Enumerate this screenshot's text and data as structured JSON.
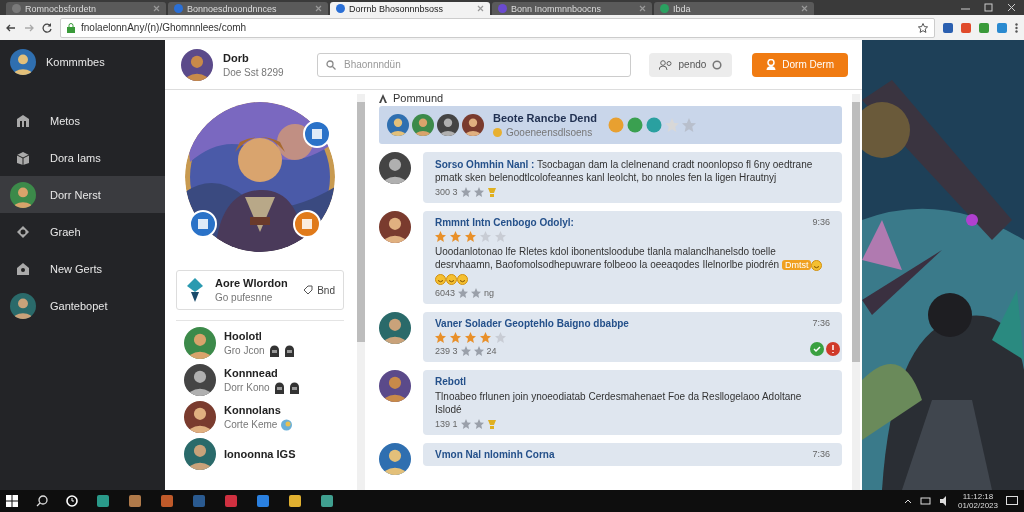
{
  "browser": {
    "tabs": [
      {
        "label": "Romnocbsfordetn",
        "selected": false
      },
      {
        "label": "Bonnoesdnoondnnces",
        "selected": false
      },
      {
        "label": "Dorrnb Bhosonnnbsoss",
        "selected": true
      },
      {
        "label": "Bonn Inommnnboocns",
        "selected": false
      },
      {
        "label": "Ibda",
        "selected": false
      }
    ],
    "url": "fnolaelonnAny/(n)/Ghomnnlees/comh"
  },
  "sidebar": {
    "title": "Kommmbes",
    "items": [
      {
        "label": "Metos",
        "kind": "icon",
        "selected": false
      },
      {
        "label": "Dora Iams",
        "kind": "icon",
        "selected": false
      },
      {
        "label": "Dorr Nerst",
        "kind": "avatar",
        "selected": true
      },
      {
        "label": "Graeh",
        "kind": "icon",
        "selected": false
      },
      {
        "label": "New Gerts",
        "kind": "icon",
        "selected": false
      },
      {
        "label": "Gantebopet",
        "kind": "avatar",
        "selected": false
      }
    ]
  },
  "header": {
    "name": "Dorb",
    "subtitle": "Doe Sst 8299",
    "search": {
      "placeholder": "Bhaonnndün"
    },
    "buttons": [
      {
        "label": "pendo",
        "kind": "secondary"
      },
      {
        "label": "Dorm Derm",
        "kind": "primary"
      }
    ]
  },
  "profile": {
    "card": {
      "name": "Aore Wlordon",
      "subtitle": "Go pufesnne",
      "action": "Bnd"
    },
    "friends": [
      {
        "name": "Hoolotl",
        "status": "Gro Jcon"
      },
      {
        "name": "Konnnead",
        "status": "Dorr Kono"
      },
      {
        "name": "Konnolans",
        "status": "Corte Keme"
      },
      {
        "name": "Ionoonna IGS"
      }
    ]
  },
  "comments": {
    "title": "Pommund",
    "group": {
      "title": "Beote Rancbe Dend",
      "subtitle": "Gooeneensdlsoens"
    },
    "items": [
      {
        "author": "Sorso Ohmhin Nanl :",
        "text": "Tsocbagan dam la clelnenand cradt noonlopso fl 6ny oedtrane pmatk sken belenodtlcolofeannes kanl leolcht, bo nnoles fen la ligen Hrautnyj",
        "meta": "300 3"
      },
      {
        "author": "Rmmnt Intn Cenbogo Odolyl:",
        "time": "9:36",
        "stars": 3,
        "text": "Uoodanlotonao lfe Rletes kdol ibonentsloodube tlanla malanclhanelsdo toelle desrvhaamn, Baofomolsodhepuwrare folbeoo la oeeaqodes Ilelnorlbe piodrén",
        "badge": "Dmtst",
        "meta": "6043",
        "meta_end": "ng"
      },
      {
        "author": "Vaner Solader Geoptehlo Baigno dbabpe",
        "time": "7:36",
        "stars": 4,
        "meta": "239 3",
        "meta_end": "24"
      },
      {
        "author": "Rebotl",
        "text": "Tlnoabeo frlunen join ynoeodiatab Cerdesmahenaet Foe da Resllogelaoo Adoltane Islodé",
        "meta": "139 1"
      },
      {
        "author": "Vmon Nal nlominh Corna",
        "time": "7:36"
      }
    ]
  },
  "taskbar": {
    "time": "11:12:18",
    "date": "01/02/2023"
  }
}
